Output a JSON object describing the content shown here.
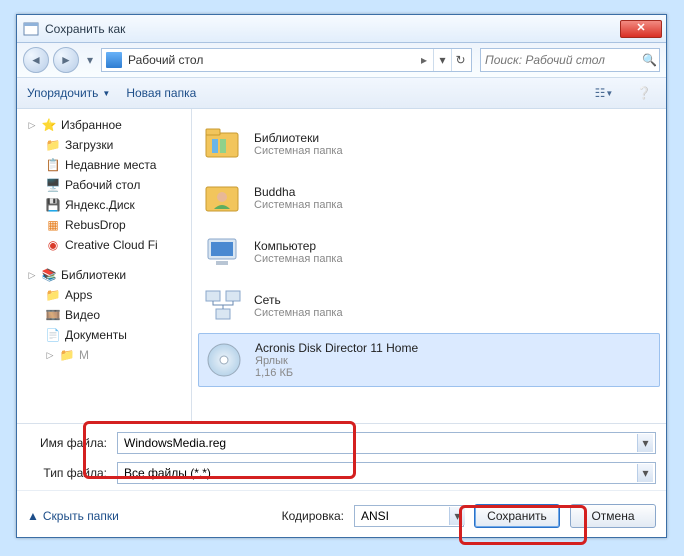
{
  "title": "Сохранить как",
  "addr": {
    "location": "Рабочий стол",
    "chevron": "▸"
  },
  "search": {
    "placeholder": "Поиск: Рабочий стол"
  },
  "toolbar": {
    "organize": "Упорядочить",
    "newfolder": "Новая папка"
  },
  "sidebar": {
    "fav": "Избранное",
    "items1": [
      "Загрузки",
      "Недавние места",
      "Рабочий стол",
      "Яндекс.Диск",
      "RebusDrop",
      "Creative Cloud Fi"
    ],
    "lib": "Библиотеки",
    "items2": [
      "Apps",
      "Видео",
      "Документы"
    ]
  },
  "content": [
    {
      "title": "Библиотеки",
      "sub": "Системная папка",
      "icon": "libraries"
    },
    {
      "title": "Buddha",
      "sub": "Системная папка",
      "icon": "user"
    },
    {
      "title": "Компьютер",
      "sub": "Системная папка",
      "icon": "computer"
    },
    {
      "title": "Сеть",
      "sub": "Системная папка",
      "icon": "network"
    },
    {
      "title": "Acronis Disk Director 11 Home",
      "sub": "Ярлык",
      "sub2": "1,16 КБ",
      "icon": "disk"
    }
  ],
  "fields": {
    "name_label": "Имя файла:",
    "name_value": "WindowsMedia.reg",
    "type_label": "Тип файла:",
    "type_value": "Все файлы  (*.*)"
  },
  "footer": {
    "hide": "Скрыть папки",
    "enc_label": "Кодировка:",
    "enc_value": "ANSI",
    "save": "Сохранить",
    "cancel": "Отмена"
  }
}
